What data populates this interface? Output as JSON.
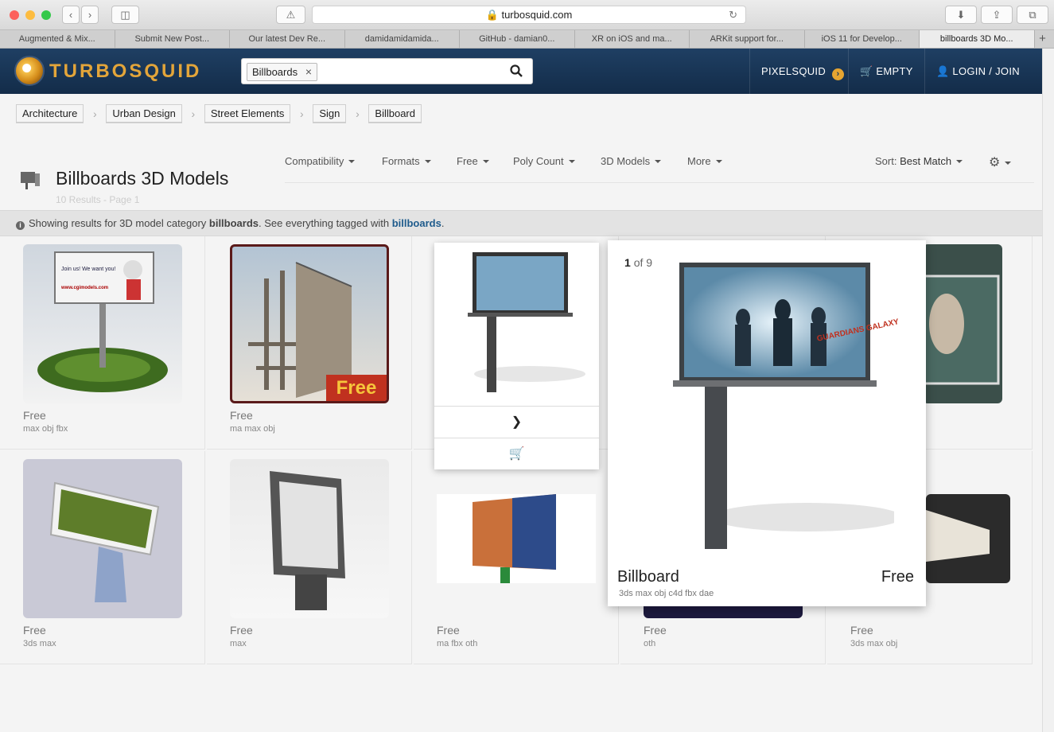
{
  "browser": {
    "url": "turbosquid.com",
    "tabs": [
      "Augmented & Mix...",
      "Submit New Post...",
      "Our latest Dev Re...",
      "damidamidamida...",
      "GitHub - damian0...",
      "XR on iOS and ma...",
      "ARKit support for...",
      "iOS 11 for Develop...",
      "billboards 3D Mo..."
    ],
    "active_tab": 8,
    "new_tab": "+"
  },
  "nav": {
    "logo": "TURBOSQUID",
    "search_chip": "Billboards",
    "search_chip_remove": "×",
    "pixelsquid": "PIXELSQUID",
    "cart": "EMPTY",
    "login": "LOGIN / JOIN"
  },
  "breadcrumbs": [
    "Architecture",
    "Urban Design",
    "Street Elements",
    "Sign",
    "Billboard"
  ],
  "header": {
    "title": "Billboards 3D Models",
    "results": "10 Results - Page 1"
  },
  "filters": [
    "Compatibility",
    "Formats",
    "Free",
    "Poly Count",
    "3D Models",
    "More"
  ],
  "sort": {
    "label": "Sort:",
    "value": "Best Match"
  },
  "info": {
    "pre": "Showing results for 3D model category ",
    "category": "billboards",
    "mid": ". See everything tagged with ",
    "tag": "billboards",
    "post": "."
  },
  "products": [
    {
      "price": "Free",
      "formats": "max obj fbx",
      "ad_line1": "Join us! We want you!",
      "ad_line2": "www.cgimodels.com"
    },
    {
      "price": "Free",
      "formats": "ma max obj",
      "badge": "Free"
    },
    {
      "price": "",
      "formats": ""
    },
    {
      "price": "",
      "formats": ""
    },
    {
      "price": "",
      "formats": ""
    },
    {
      "price": "Free",
      "formats": "3ds max"
    },
    {
      "price": "Free",
      "formats": "max"
    },
    {
      "price": "Free",
      "formats": "ma fbx oth"
    },
    {
      "price": "Free",
      "formats": "oth"
    },
    {
      "price": "Free",
      "formats": "3ds max obj"
    }
  ],
  "preview": {
    "index": "1",
    "of_label": "of 9",
    "title": "Billboard",
    "price": "Free",
    "formats": "3ds max obj c4d fbx dae",
    "poster_text": "GUARDIANS GALAXY"
  },
  "colors": {
    "nav_bg": "#1b3a5c",
    "logo": "#e3a53a",
    "link": "#1e5b8c",
    "badge_bg": "#c0311f",
    "badge_text": "#f6c53b"
  }
}
